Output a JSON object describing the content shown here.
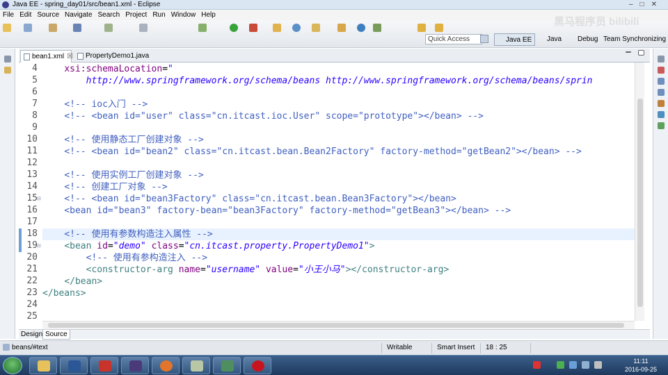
{
  "window": {
    "title": "Java EE - spring_day01/src/bean1.xml - Eclipse"
  },
  "menu": [
    "File",
    "Edit",
    "Source",
    "Navigate",
    "Search",
    "Project",
    "Run",
    "Window",
    "Help"
  ],
  "quick_access": {
    "placeholder": "Quick Access"
  },
  "perspectives": {
    "javaee": "Java EE",
    "java": "Java",
    "debug": "Debug",
    "team": "Team Synchronizing"
  },
  "tabs": [
    {
      "label": "bean1.xml",
      "close": "☒"
    },
    {
      "label": "PropertyDemo1.java"
    }
  ],
  "editor": {
    "lines": [
      {
        "n": "4",
        "segs": [
          {
            "t": "    "
          },
          {
            "t": "xsi:schemaLocation",
            "c": "a"
          },
          {
            "t": "=",
            "c": "p"
          },
          {
            "t": "\"",
            "c": "v2"
          }
        ]
      },
      {
        "n": "5",
        "segs": [
          {
            "t": "        "
          },
          {
            "t": "http://www.springframework.org/schema/beans http://www.springframework.org/schema/beans/sprin",
            "c": "v"
          }
        ]
      },
      {
        "n": "6",
        "segs": []
      },
      {
        "n": "7",
        "segs": [
          {
            "t": "    "
          },
          {
            "t": "<!-- ioc入门 -->",
            "c": "c"
          }
        ]
      },
      {
        "n": "8",
        "segs": [
          {
            "t": "    "
          },
          {
            "t": "<!-- <bean id=\"user\" class=\"cn.itcast.ioc.User\" scope=\"prototype\"></bean> -->",
            "c": "c"
          }
        ]
      },
      {
        "n": "9",
        "segs": []
      },
      {
        "n": "10",
        "segs": [
          {
            "t": "    "
          },
          {
            "t": "<!-- 使用静态工厂创建对象 -->",
            "c": "c"
          }
        ]
      },
      {
        "n": "11",
        "segs": [
          {
            "t": "    "
          },
          {
            "t": "<!-- <bean id=\"bean2\" class=\"cn.itcast.bean.Bean2Factory\" factory-method=\"getBean2\"></bean> -->",
            "c": "c"
          }
        ]
      },
      {
        "n": "12",
        "segs": []
      },
      {
        "n": "13",
        "segs": [
          {
            "t": "    "
          },
          {
            "t": "<!-- 使用实例工厂创建对象 -->",
            "c": "c"
          }
        ]
      },
      {
        "n": "14",
        "segs": [
          {
            "t": "    "
          },
          {
            "t": "<!-- 创建工厂对象 -->",
            "c": "c"
          }
        ]
      },
      {
        "n": "15",
        "segs": [
          {
            "t": "    "
          },
          {
            "t": "<!-- <bean id=\"bean3Factory\" class=\"cn.itcast.bean.Bean3Factory\"></bean>",
            "c": "c"
          }
        ]
      },
      {
        "n": "16",
        "segs": [
          {
            "t": "    "
          },
          {
            "t": "<bean id=\"bean3\" factory-bean=\"bean3Factory\" factory-method=\"getBean3\"></bean> -->",
            "c": "c"
          }
        ]
      },
      {
        "n": "17",
        "segs": []
      },
      {
        "n": "18",
        "segs": [
          {
            "t": "    "
          },
          {
            "t": "<!-- 使用有参数构造注入属性 -->",
            "c": "c"
          }
        ]
      },
      {
        "n": "19",
        "segs": [
          {
            "t": "    "
          },
          {
            "t": "<bean ",
            "c": "t"
          },
          {
            "t": "id",
            "c": "a"
          },
          {
            "t": "=",
            "c": "p"
          },
          {
            "t": "\"demo\"",
            "c": "v"
          },
          {
            "t": " "
          },
          {
            "t": "class",
            "c": "a"
          },
          {
            "t": "=",
            "c": "p"
          },
          {
            "t": "\"cn.itcast.property.PropertyDemo1\"",
            "c": "v"
          },
          {
            "t": ">",
            "c": "t"
          }
        ]
      },
      {
        "n": "20",
        "segs": [
          {
            "t": "        "
          },
          {
            "t": "<!-- 使用有参构造注入 -->",
            "c": "c"
          }
        ]
      },
      {
        "n": "21",
        "segs": [
          {
            "t": "        "
          },
          {
            "t": "<constructor-arg ",
            "c": "t"
          },
          {
            "t": "name",
            "c": "a"
          },
          {
            "t": "=",
            "c": "p"
          },
          {
            "t": "\"username\"",
            "c": "v"
          },
          {
            "t": " "
          },
          {
            "t": "value",
            "c": "a"
          },
          {
            "t": "=",
            "c": "p"
          },
          {
            "t": "\"小王小马\"",
            "c": "v"
          },
          {
            "t": "></constructor-arg>",
            "c": "t"
          }
        ]
      },
      {
        "n": "22",
        "segs": [
          {
            "t": "    "
          },
          {
            "t": "</bean>",
            "c": "t"
          }
        ]
      },
      {
        "n": "23",
        "segs": [
          {
            "t": "</beans>",
            "c": "t"
          }
        ]
      },
      {
        "n": "24",
        "segs": []
      },
      {
        "n": "25",
        "segs": []
      }
    ]
  },
  "editor_tabs": [
    "Design",
    "Source"
  ],
  "status": {
    "path": "beans/#text",
    "mode": "Writable",
    "insert": "Smart Insert",
    "position": "18 : 25"
  },
  "clock": {
    "time": "11:11",
    "date": "2016-09-25"
  },
  "watermark": "黑马程序员 bilibili",
  "colors": {
    "comment": "#3f5fbf",
    "tag": "#3f7f7f",
    "attr": "#7f007f",
    "value": "#2a00ff",
    "current_line": "#e8f2fe"
  }
}
